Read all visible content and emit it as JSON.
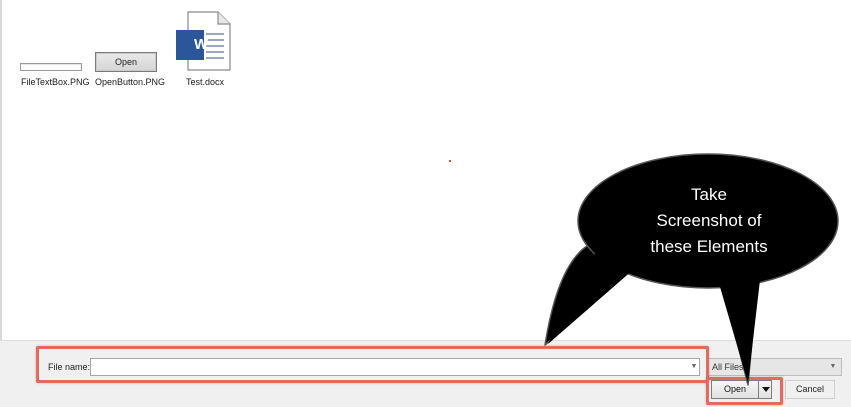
{
  "files": [
    {
      "name": "FileTextBox.PNG",
      "icon": "textbox-thumbnail-icon"
    },
    {
      "name": "OpenButton.PNG",
      "icon": "open-button-thumbnail-icon",
      "thumbnail_text": "Open"
    },
    {
      "name": "Test.docx",
      "icon": "word-document-icon",
      "badge": "W"
    }
  ],
  "dialog": {
    "file_name_label": "File name:",
    "file_name_value": "",
    "file_type_value": "All Files",
    "open_label": "Open",
    "cancel_label": "Cancel"
  },
  "callout": {
    "lines": [
      "Take",
      "Screenshot of",
      "these Elements"
    ]
  },
  "colors": {
    "highlight": "#e26a5e",
    "bubble": "#000000",
    "word_blue": "#2b579a"
  }
}
